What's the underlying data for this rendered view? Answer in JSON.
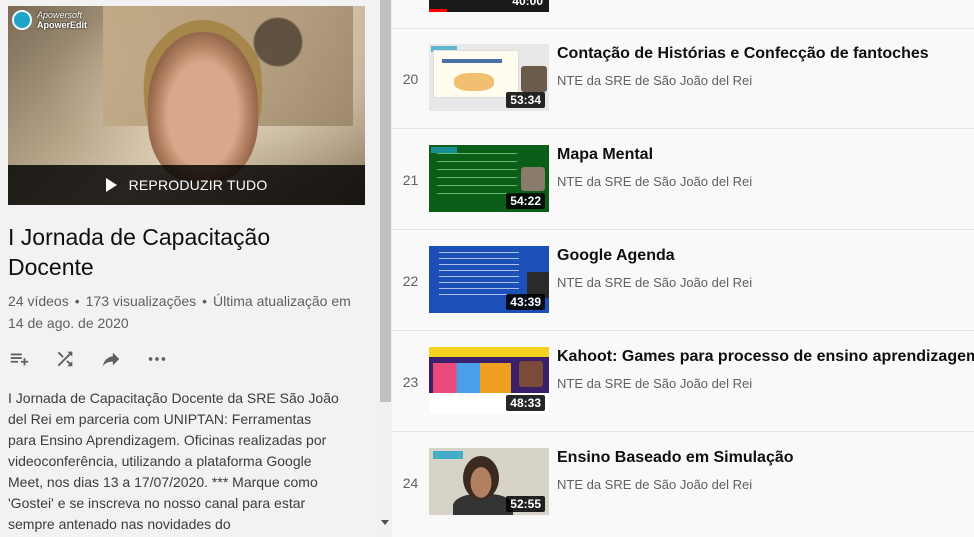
{
  "sidebar": {
    "brand": {
      "line1": "Apowersoft",
      "line2": "ApowerEdit"
    },
    "play_all_label": "REPRODUZIR TUDO",
    "title": "I Jornada de Capacitação Docente",
    "stats": {
      "videos": "24 vídeos",
      "views": "173 visualizações",
      "updated": "Última atualização em 14 de ago. de 2020"
    },
    "actions": [
      "add-to-queue-icon",
      "shuffle-icon",
      "share-icon",
      "more-icon"
    ],
    "description": "I Jornada de Capacitação Docente da SRE São João del Rei em parceria com UNIPTAN: Ferramentas para Ensino Aprendizagem. Oficinas realizadas por videoconferência, utilizando a plataforma Google Meet, nos dias 13 a 17/07/2020. *** Marque como 'Gostei' e se inscreva no nosso canal para estar sempre antenado nas novidades do"
  },
  "previous_item": {
    "duration": "40:00"
  },
  "videos": [
    {
      "index": "20",
      "title": "Contação de Histórias e Confecção de fantoches",
      "channel": "NTE da SRE de São João del Rei",
      "duration": "53:34"
    },
    {
      "index": "21",
      "title": "Mapa Mental",
      "channel": "NTE da SRE de São João del Rei",
      "duration": "54:22"
    },
    {
      "index": "22",
      "title": "Google Agenda",
      "channel": "NTE da SRE de São João del Rei",
      "duration": "43:39"
    },
    {
      "index": "23",
      "title": "Kahoot: Games para processo de ensino aprendizagem",
      "channel": "NTE da SRE de São João del Rei",
      "duration": "48:33"
    },
    {
      "index": "24",
      "title": "Ensino Baseado em Simulação",
      "channel": "NTE da SRE de São João del Rei",
      "duration": "52:55"
    }
  ]
}
